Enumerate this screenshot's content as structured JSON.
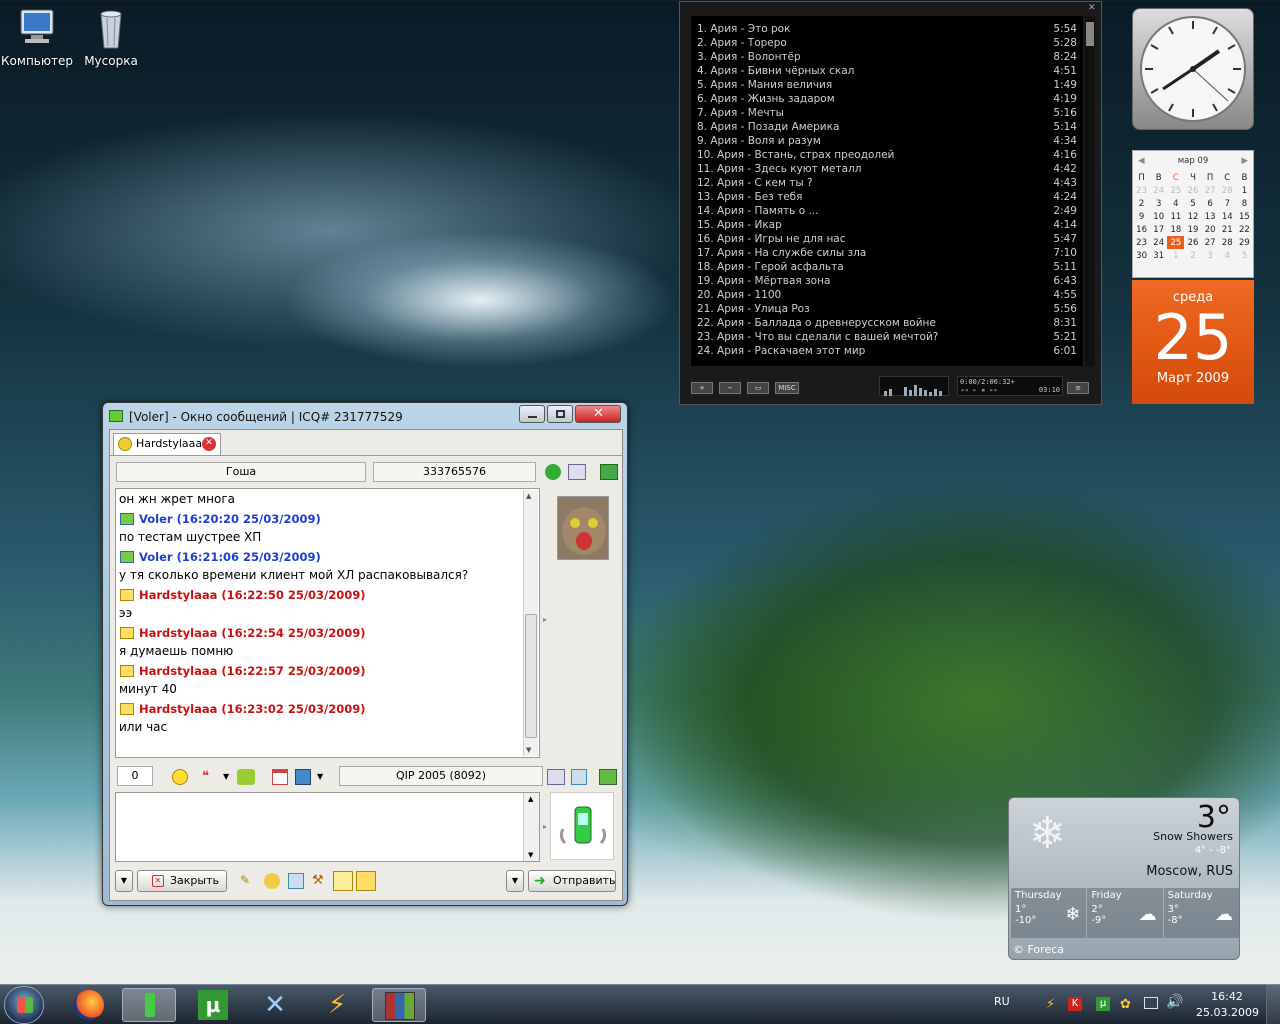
{
  "desktop": {
    "icons": [
      {
        "label": "Компьютер",
        "icon": "computer-icon"
      },
      {
        "label": "Мусорка",
        "icon": "recycle-bin-icon"
      }
    ]
  },
  "player": {
    "playlist": [
      {
        "n": "1. Ария - Это рок",
        "t": "5:54"
      },
      {
        "n": "2. Ария - Тореро",
        "t": "5:28"
      },
      {
        "n": "3. Ария - Волонтёр",
        "t": "8:24"
      },
      {
        "n": "4. Ария - Бивни чёрных скал",
        "t": "4:51"
      },
      {
        "n": "5. Ария - Мания величия",
        "t": "1:49"
      },
      {
        "n": "6. Ария - Жизнь задаром",
        "t": "4:19"
      },
      {
        "n": "7. Ария - Мечты",
        "t": "5:16"
      },
      {
        "n": "8. Ария - Позади Америка",
        "t": "5:14"
      },
      {
        "n": "9. Ария - Воля и разум",
        "t": "4:34"
      },
      {
        "n": "10. Ария - Встань, страх преодолей",
        "t": "4:16"
      },
      {
        "n": "11. Ария - Здесь куют металл",
        "t": "4:42"
      },
      {
        "n": "12. Ария - С кем ты ?",
        "t": "4:43"
      },
      {
        "n": "13. Ария - Без тебя",
        "t": "4:24"
      },
      {
        "n": "14. Ария - Память о ...",
        "t": "2:49"
      },
      {
        "n": "15. Ария - Икар",
        "t": "4:14"
      },
      {
        "n": "16. Ария - Игры не для нас",
        "t": "5:47"
      },
      {
        "n": "17. Ария - На службе силы зла",
        "t": "7:10"
      },
      {
        "n": "18. Ария - Герой асфальта",
        "t": "5:11"
      },
      {
        "n": "19. Ария - Мёртвая зона",
        "t": "6:43"
      },
      {
        "n": "20. Ария - 1100",
        "t": "4:55"
      },
      {
        "n": "21. Ария - Улица Роз",
        "t": "5:56"
      },
      {
        "n": "22. Ария - Баллада о древнерусском войне",
        "t": "8:31"
      },
      {
        "n": "23. Ария - Что вы сделали с вашей мечтой?",
        "t": "5:21"
      },
      {
        "n": "24. Ария - Раскачаем этот мир",
        "t": "6:01"
      }
    ],
    "buttons": {
      "add": "+",
      "rem": "−",
      "sel": "▭",
      "misc": "MISC",
      "list": "≡"
    },
    "time_readout": "0:00/2:06:32+",
    "time_small": "03:10"
  },
  "calendar": {
    "month": "мар 09",
    "weekdays": [
      "П",
      "В",
      "С",
      "Ч",
      "П",
      "С",
      "В"
    ],
    "weeks": [
      [
        "23",
        "24",
        "25",
        "26",
        "27",
        "28",
        "1"
      ],
      [
        "2",
        "3",
        "4",
        "5",
        "6",
        "7",
        "8"
      ],
      [
        "9",
        "10",
        "11",
        "12",
        "13",
        "14",
        "15"
      ],
      [
        "16",
        "17",
        "18",
        "19",
        "20",
        "21",
        "22"
      ],
      [
        "23",
        "24",
        "25",
        "26",
        "27",
        "28",
        "29"
      ],
      [
        "30",
        "31",
        "1",
        "2",
        "3",
        "4",
        "5"
      ]
    ],
    "day_name": "среда",
    "day_num": "25",
    "month_year": "Март 2009"
  },
  "weather": {
    "temp": "3°",
    "condition": "Snow Showers",
    "range": "4° - -8°",
    "city": "Moscow, RUS",
    "days": [
      {
        "name": "Thursday",
        "hi": "1°",
        "lo": "-10°"
      },
      {
        "name": "Friday",
        "hi": "2°",
        "lo": "-9°"
      },
      {
        "name": "Saturday",
        "hi": "3°",
        "lo": "-8°"
      }
    ],
    "credit": "© Foreca"
  },
  "qip": {
    "title": "[Voler] - Окно сообщений | ICQ# 231777529",
    "tab": "Hardstylaaa",
    "contact_name": "Гоша",
    "contact_uin": "333765576",
    "messages": [
      {
        "type": "text",
        "text": "он жн жрет многа"
      },
      {
        "type": "head",
        "who": "blue",
        "text": "Voler (16:20:20 25/03/2009)"
      },
      {
        "type": "text",
        "text": "по тестам шустрее ХП"
      },
      {
        "type": "head",
        "who": "blue",
        "text": "Voler (16:21:06 25/03/2009)"
      },
      {
        "type": "text",
        "text": "у тя сколько времени клиент мой ХЛ распаковывался?"
      },
      {
        "type": "head",
        "who": "red",
        "text": "Hardstylaaa (16:22:50 25/03/2009)"
      },
      {
        "type": "text",
        "text": "ээ"
      },
      {
        "type": "head",
        "who": "red",
        "text": "Hardstylaaa (16:22:54 25/03/2009)"
      },
      {
        "type": "text",
        "text": "я думаешь помню"
      },
      {
        "type": "head",
        "who": "red",
        "text": "Hardstylaaa (16:22:57 25/03/2009)"
      },
      {
        "type": "text",
        "text": "минут 40"
      },
      {
        "type": "head",
        "who": "red",
        "text": "Hardstylaaa (16:23:02 25/03/2009)"
      },
      {
        "type": "text",
        "text": "или час"
      }
    ],
    "char_count": "0",
    "client": "QIP 2005 (8092)",
    "input_value": "",
    "close_label": "Закрыть",
    "send_label": "Отправить"
  },
  "taskbar": {
    "lang": "RU",
    "time": "16:42",
    "date": "25.03.2009"
  },
  "colors": {
    "accent": "#e8601c",
    "blue_nick": "#1c3fd0",
    "red_nick": "#cc1010"
  }
}
